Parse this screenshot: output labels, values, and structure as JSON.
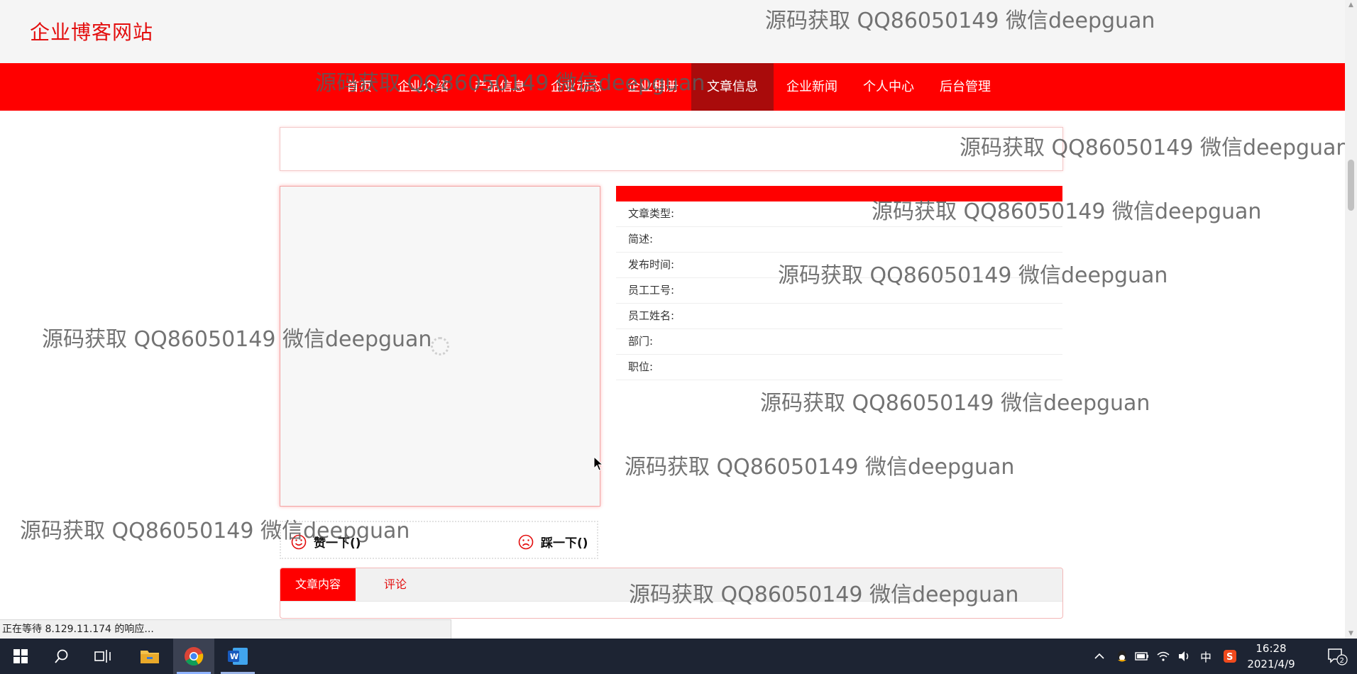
{
  "site": {
    "title": "企业博客网站"
  },
  "nav": {
    "items": [
      "首页",
      "企业介绍",
      "产品信息",
      "企业动态",
      "企业相册",
      "文章信息",
      "企业新闻",
      "个人中心",
      "后台管理"
    ],
    "active_index": 5
  },
  "info": {
    "fields": [
      "文章类型:",
      "简述:",
      "发布时间:",
      "员工工号:",
      "员工姓名:",
      "部门:",
      "职位:"
    ]
  },
  "vote": {
    "like_label": "赞一下()",
    "dislike_label": "踩一下()"
  },
  "tabs": {
    "items": [
      "文章内容",
      "评论"
    ],
    "active_index": 0
  },
  "watermark": "源码获取 QQ86050149 微信deepguan",
  "status_text": "正在等待 8.129.11.174 的响应...",
  "taskbar": {
    "time": "16:28",
    "date": "2021/4/9",
    "ime": "中",
    "notifications": "2",
    "apps": [
      "start-icon",
      "search-icon",
      "task-view-icon",
      "file-explorer-icon",
      "chrome-icon",
      "word-icon"
    ]
  },
  "colors": {
    "brand_red": "#ff0000",
    "active_nav": "#a90b0b",
    "taskbar": "#1d2433"
  }
}
